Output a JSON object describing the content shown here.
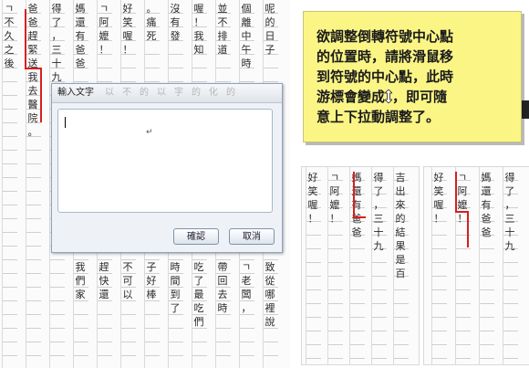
{
  "left_sheet": {
    "columns": [
      {
        "chars": "呢的日子"
      },
      {
        "chars": "個離中午時"
      },
      {
        "chars": "並不排道"
      },
      {
        "chars": "喔！我知"
      },
      {
        "chars": "沒有發"
      },
      {
        "chars": "。痛死"
      },
      {
        "chars": "好笑喔！"
      },
      {
        "chars": "ㄱ阿嬤！"
      },
      {
        "chars": "媽還有爸爸"
      },
      {
        "chars": "得了，三十九"
      },
      {
        "chars": "爸爸趕緊送我去醫院。"
      },
      {
        "chars": "ㄱ不久之後"
      }
    ],
    "lower_columns": [
      {
        "chars": "致從哪裡說"
      },
      {
        "chars": "ㄱ老闆，"
      },
      {
        "chars": "帶回去時"
      },
      {
        "chars": "吃了最吃們"
      },
      {
        "chars": "時間到了"
      },
      {
        "chars": "子好棒"
      },
      {
        "chars": "不可以"
      },
      {
        "chars": "趕快還"
      },
      {
        "chars": "我們家"
      }
    ]
  },
  "dialog": {
    "title": "輸入文字",
    "toolbar_glyphs": [
      "以",
      "不",
      "的",
      "以",
      "字",
      "的",
      "化",
      "的"
    ],
    "text_value": "",
    "return_mark": "↵",
    "ok_label": "確認",
    "cancel_label": "取消"
  },
  "callout": {
    "text_before_icon": "欲調整倒轉符號中心點\n的位置時，請將滑鼠移\n到符號的中心點，此時\n游標會變成",
    "text_after_icon": "，即可隨\n意上下拉動調整了。",
    "icon": "vertical-resize-cursor-icon",
    "background_color": "#fbf586"
  },
  "sample_a": {
    "columns": [
      {
        "chars": "吉出來的結果是百"
      },
      {
        "chars": "得了，三十九"
      },
      {
        "chars": "媽還有爸爸"
      },
      {
        "chars": "ㄱ阿嬤！"
      },
      {
        "chars": "好笑喔！"
      }
    ]
  },
  "sample_b": {
    "columns": [
      {
        "chars": "得了，三十九"
      },
      {
        "chars": "媽還有爸爸"
      },
      {
        "chars": "ㄱ阿嬤！"
      },
      {
        "chars": "好笑喔！"
      }
    ]
  },
  "colors": {
    "annotation_red": "#d81e1e",
    "dialog_border": "#8da3c0"
  }
}
